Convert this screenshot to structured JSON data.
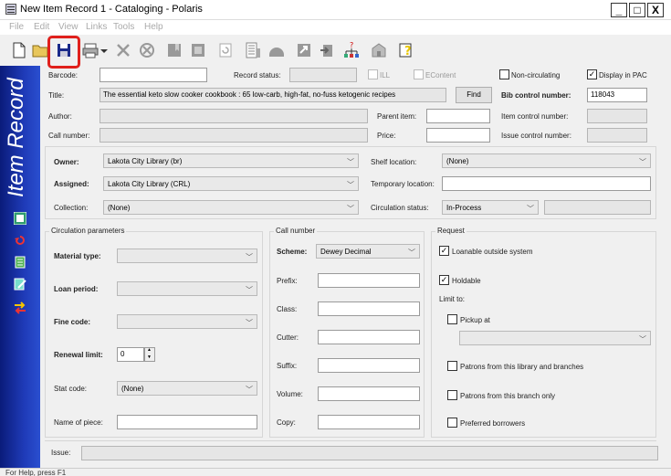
{
  "window": {
    "title": "New Item Record 1 - Cataloging  - Polaris",
    "minimize": "_",
    "maximize": "□",
    "close": "X"
  },
  "menu": [
    "File",
    "Edit",
    "View",
    "Links",
    "Tools",
    "Help"
  ],
  "toolbar": {
    "icons": [
      "new-icon",
      "open-folder-icon",
      "save-icon",
      "print-icon",
      "print-dropdown-icon",
      "delete-icon",
      "cancel-icon",
      "bookmark-icon",
      "copy-icon",
      "refresh-icon",
      "bib-record-icon",
      "search-icon",
      "link-icon",
      "export-icon",
      "hierarchy-icon",
      "patron-icon",
      "help-icon"
    ]
  },
  "sidebar": {
    "title": "Item Record",
    "icons": [
      "record-view-icon",
      "undo-icon",
      "notes-icon",
      "edit-icon",
      "transfer-icon"
    ]
  },
  "form": {
    "barcode_label": "Barcode:",
    "barcode_value": "",
    "record_status_label": "Record status:",
    "record_status_value": "",
    "ill_label": "ILL",
    "econtent_label": "EContent",
    "non_circulating_label": "Non-circulating",
    "display_in_pac_label": "Display in PAC",
    "title_label": "Title:",
    "title_value": "The essential keto slow cooker cookbook : 65 low-carb, high-fat, no-fuss ketogenic recipes",
    "find_label": "Find",
    "bib_control_label": "Bib control number:",
    "bib_control_value": "118043",
    "author_label": "Author:",
    "parent_item_label": "Parent item:",
    "item_control_label": "Item control number:",
    "call_number_label": "Call number:",
    "price_label": "Price:",
    "issue_control_label": "Issue control number:",
    "owner_label": "Owner:",
    "owner_value": "Lakota City Library (br)",
    "assigned_label": "Assigned:",
    "assigned_value": "Lakota City Library (CRL)",
    "collection_label": "Collection:",
    "collection_value": "(None)",
    "shelf_location_label": "Shelf location:",
    "shelf_location_value": "(None)",
    "temporary_location_label": "Temporary location:",
    "circulation_status_label": "Circulation status:",
    "circulation_status_value": "In-Process",
    "issue_label": "Issue:"
  },
  "circulation": {
    "group_title": "Circulation parameters",
    "material_type_label": "Material type:",
    "loan_period_label": "Loan period:",
    "fine_code_label": "Fine code:",
    "renewal_limit_label": "Renewal limit:",
    "renewal_limit_value": "0",
    "stat_code_label": "Stat code:",
    "stat_code_value": "(None)",
    "name_of_piece_label": "Name of piece:"
  },
  "call_number": {
    "group_title": "Call number",
    "scheme_label": "Scheme:",
    "scheme_value": "Dewey Decimal",
    "prefix_label": "Prefix:",
    "class_label": "Class:",
    "cutter_label": "Cutter:",
    "suffix_label": "Suffix:",
    "volume_label": "Volume:",
    "copy_label": "Copy:"
  },
  "request": {
    "group_title": "Request",
    "loanable_outside_label": "Loanable outside system",
    "holdable_label": "Holdable",
    "limit_to_label": "Limit to:",
    "pickup_at_label": "Pickup at",
    "patrons_library_label": "Patrons from this library and branches",
    "patrons_branch_label": "Patrons from this branch only",
    "preferred_borrowers_label": "Preferred borrowers"
  },
  "status": {
    "text": "For Help, press F1"
  }
}
